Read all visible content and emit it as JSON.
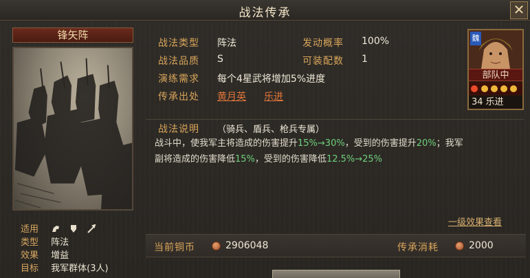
{
  "window": {
    "title": "战法传承",
    "close_label": "✕"
  },
  "skill": {
    "name": "锋矢阵",
    "attributes": [
      {
        "key": "适用",
        "value": "",
        "arms": [
          "cavalry-icon",
          "shield-icon",
          "spear-icon"
        ]
      },
      {
        "key": "类型",
        "value": "阵法"
      },
      {
        "key": "效果",
        "value": "增益"
      },
      {
        "key": "目标",
        "value": "我军群体(3人)"
      }
    ]
  },
  "info": {
    "type_label": "战法类型",
    "type_value": "阵法",
    "rate_label": "发动概率",
    "rate_value": "100%",
    "quality_label": "战法品质",
    "quality_value": "S",
    "slots_label": "可装配数",
    "slots_value": "1",
    "req_label": "演练需求",
    "req_value": "每个4星武将增加5%进度",
    "source_label": "传承出处",
    "source_heroes": [
      "黄月英",
      "乐进"
    ]
  },
  "hero": {
    "faction": "魏",
    "unit": "部队中",
    "level_name": "34 乐进",
    "stars": 5
  },
  "description": {
    "label": "战法说明",
    "arms_note": "（骑兵、盾兵、枪兵专属）",
    "p1_a": "战斗中，使我军主将造成的伤害提升",
    "p1_b": "15%→30%",
    "p1_c": "，受到的伤害提升",
    "p1_d": "20%",
    "p1_e": "；我军",
    "p2_a": "副将造成的伤害降低",
    "p2_b": "15%",
    "p2_c": "，受到的伤害降低",
    "p2_d": "12.5%→25%"
  },
  "more_link": "一级效果查看",
  "footer": {
    "coins_label": "当前铜币",
    "coins_value": "2906048",
    "cost_label": "传承消耗",
    "cost_value": "2000"
  },
  "colors": {
    "accent": "#d9a55a",
    "highlight": "#6fd07a",
    "link": "#e0763a"
  }
}
